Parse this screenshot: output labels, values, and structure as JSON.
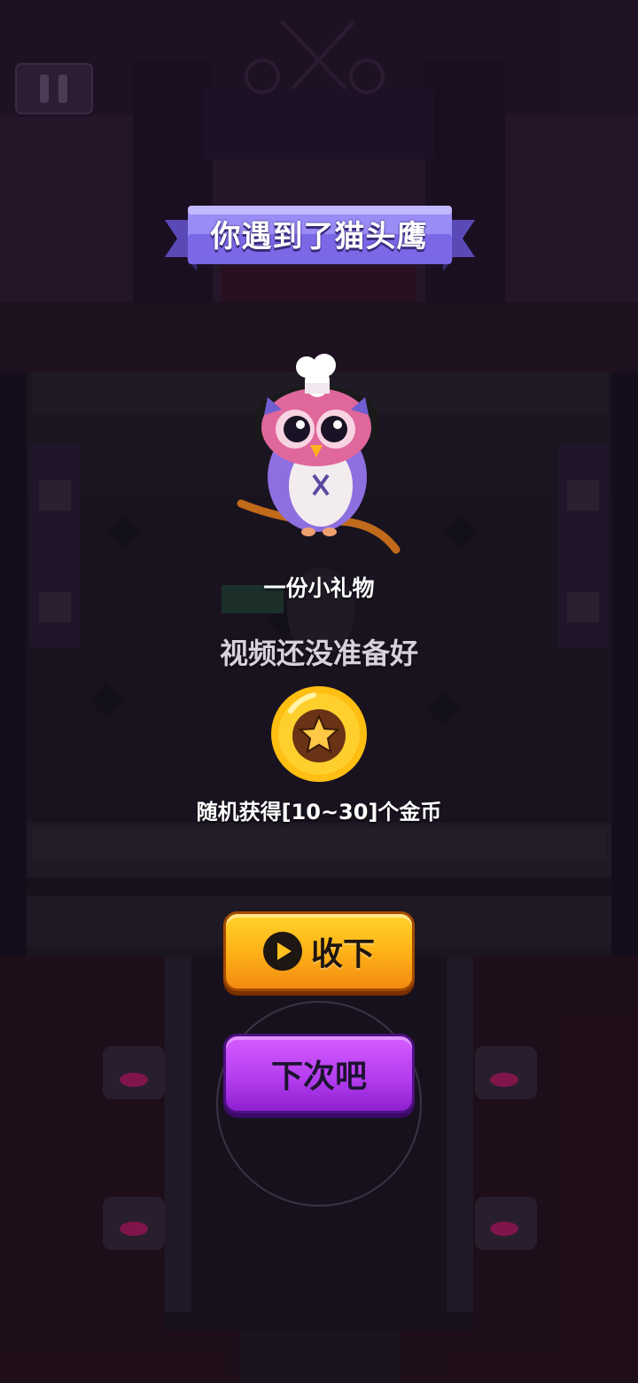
{
  "banner": {
    "title": "你遇到了猫头鹰"
  },
  "reward": {
    "heading": "一份小礼物",
    "status": "视频还没准备好",
    "description": "随机获得[10~30]个金币",
    "icon": "gold-star-coin-icon"
  },
  "buttons": {
    "accept_label": "收下",
    "accept_icon": "video-play-icon",
    "decline_label": "下次吧"
  },
  "colors": {
    "accept_button": "#ffb418",
    "decline_button": "#b53ef0",
    "banner": "#8c7cf2",
    "coin": "#ffbe12"
  }
}
